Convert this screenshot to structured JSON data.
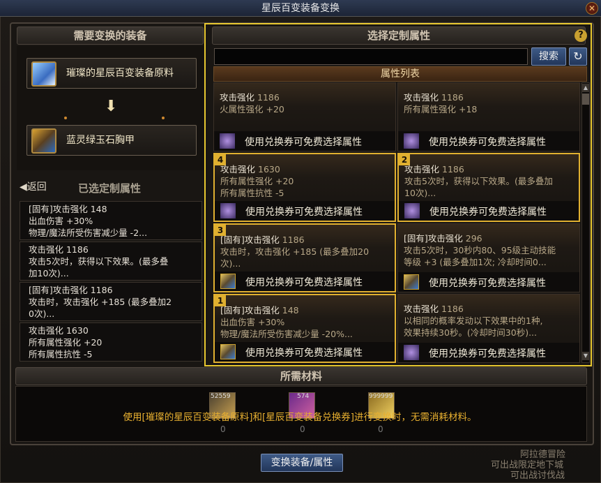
{
  "window": {
    "title": "星辰百变装备变换",
    "close": "✕"
  },
  "left": {
    "header": "需要变换的装备",
    "material": "璀璨的星辰百变装备原料",
    "target": "蓝灵绿玉石胸甲",
    "back": "◀返回",
    "selected_header": "已选定制属性",
    "selected": [
      {
        "l1": "[固有]攻击强化 148",
        "l2": "出血伤害 +30%",
        "l3": "物理/魔法所受伤害减少量 -2..."
      },
      {
        "l1": "攻击强化 1186",
        "l2": "攻击5次时，获得以下效果。(最多叠",
        "l3": "加10次)..."
      },
      {
        "l1": "[固有]攻击强化 1186",
        "l2": "攻击时，攻击强化 +185 (最多叠加2",
        "l3": "0次)..."
      },
      {
        "l1": "攻击强化 1630",
        "l2": "所有属性强化 +20",
        "l3": "所有属性抗性 -5"
      }
    ]
  },
  "right": {
    "header": "选择定制属性",
    "help": "?",
    "search_value": "",
    "search_btn": "搜索",
    "refresh": "↻",
    "list_header": "属性列表",
    "footer_text": "使用兑换券可免费选择属性",
    "cards": [
      {
        "badge": "",
        "l1": "攻击强化",
        "v1": "1186",
        "l2": "火属性强化 +20",
        "l3": ""
      },
      {
        "badge": "",
        "l1": "攻击强化",
        "v1": "1186",
        "l2": "所有属性强化 +18",
        "l3": ""
      },
      {
        "badge": "4",
        "l1": "攻击强化",
        "v1": "1630",
        "l2": "所有属性强化 +20",
        "l3": "所有属性抗性 -5"
      },
      {
        "badge": "2",
        "l1": "攻击强化",
        "v1": "1186",
        "l2": "攻击5次时，获得以下效果。(最多叠加",
        "l3": "10次)..."
      },
      {
        "badge": "3",
        "l1": "[固有]攻击强化",
        "v1": "1186",
        "l2": "攻击时，攻击强化 +185 (最多叠加20",
        "l3": "次)..."
      },
      {
        "badge": "",
        "l1": "[固有]攻击强化",
        "v1": "296",
        "l2": "攻击5次时，30秒内80、95级主动技能",
        "l3": "等级 +3 (最多叠加1次; 冷却时间0..."
      },
      {
        "badge": "1",
        "l1": "[固有]攻击强化",
        "v1": "148",
        "l2": "出血伤害 +30%",
        "l3": "物理/魔法所受伤害减少量 -20%..."
      },
      {
        "badge": "",
        "l1": "攻击强化",
        "v1": "1186",
        "l2": "以相同的概率发动以下效果中的1种,",
        "l3": "效果持续30秒。(冷却时间30秒)..."
      }
    ]
  },
  "materials": {
    "header": "所需材料",
    "counts": [
      "52559",
      "574",
      "999999"
    ],
    "needs": [
      "0",
      "0",
      "0"
    ],
    "note": "使用[璀璨的星辰百变装备原料]和[星辰百变装备兑换券]进行变换时，无需消耗材料。"
  },
  "convert_btn": "变换装备/属性",
  "bg_text": {
    "l1": "阿拉德冒险",
    "l2": "可出战限定地下城",
    "l3": "可出战讨伐战"
  },
  "colors": {
    "accent": "#e0b030"
  }
}
